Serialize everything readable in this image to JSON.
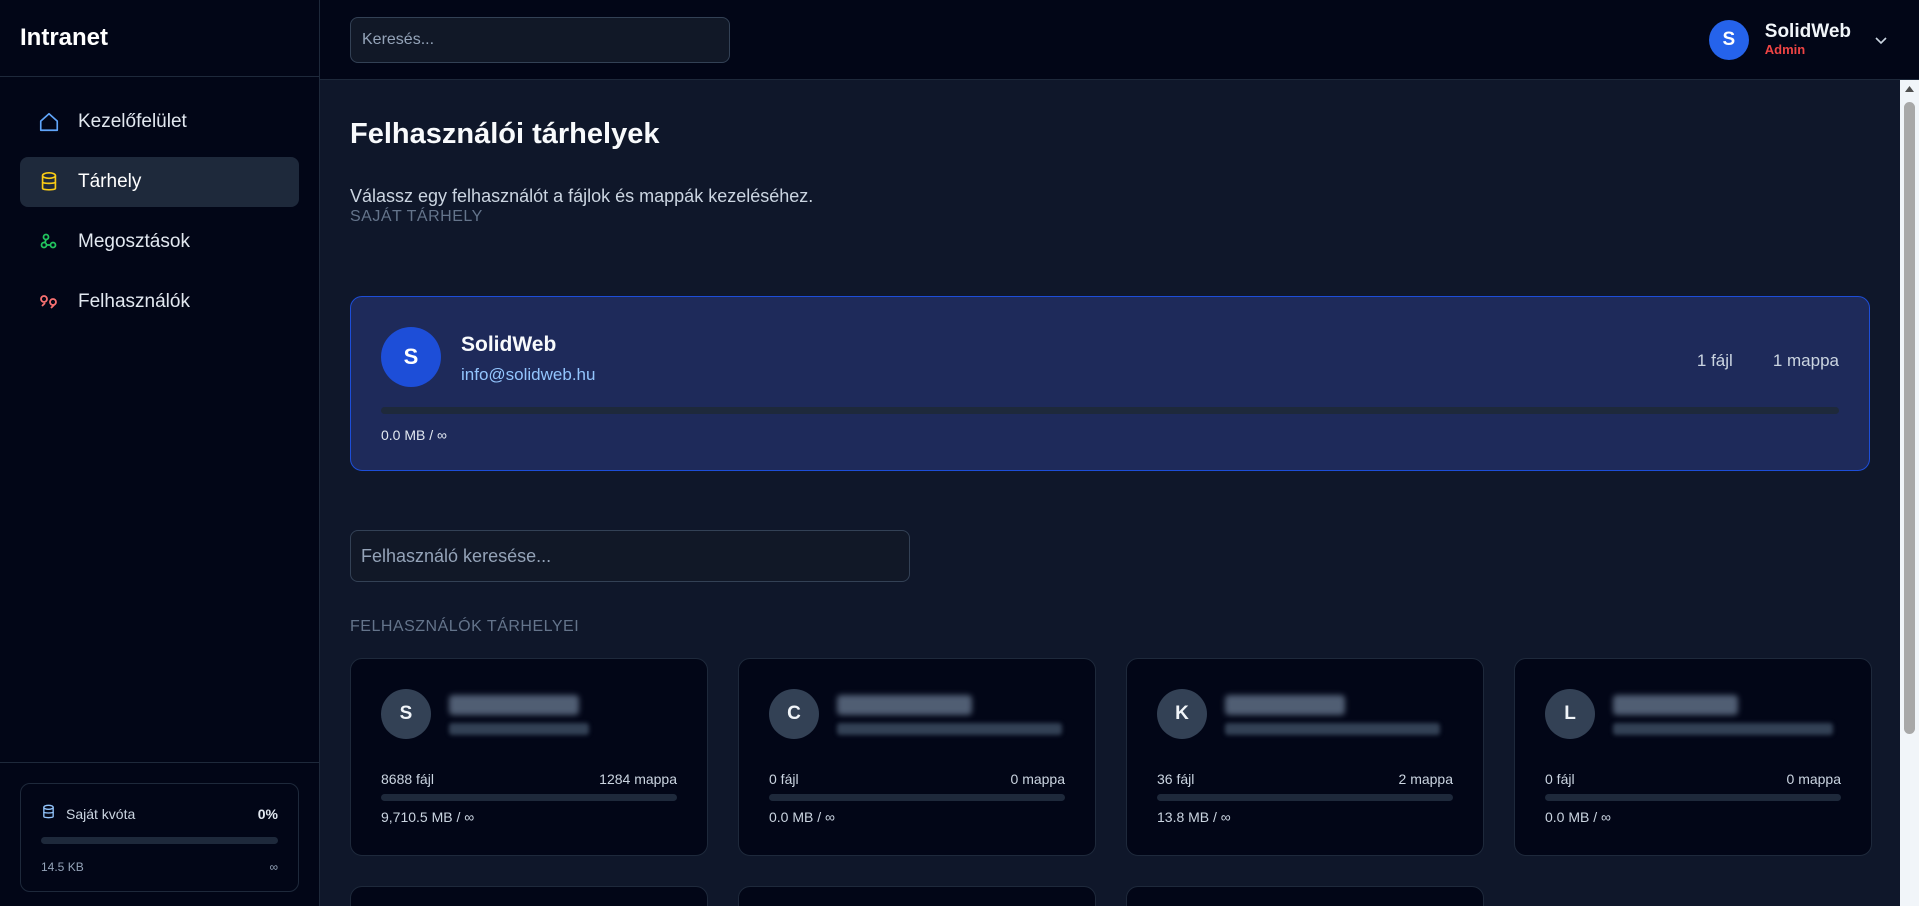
{
  "sidebar": {
    "brand": "Intranet",
    "items": [
      {
        "label": "Kezelőfelület",
        "icon": "home-icon",
        "color": "#60a5fa"
      },
      {
        "label": "Tárhely",
        "icon": "database-icon",
        "color": "#facc15"
      },
      {
        "label": "Megosztások",
        "icon": "share-icon",
        "color": "#22c55e"
      },
      {
        "label": "Felhasználók",
        "icon": "users-icon",
        "color": "#f87171"
      }
    ],
    "quota": {
      "label": "Saját kvóta",
      "percent": "0%",
      "used": "14.5 KB",
      "limit": "∞",
      "fill_fraction": 0
    }
  },
  "header": {
    "search_placeholder": "Keresés...",
    "user": {
      "initial": "S",
      "name": "SolidWeb",
      "role": "Admin"
    }
  },
  "main": {
    "title": "Felhasználói tárhelyek",
    "subtitle": "Válassz egy felhasználót a fájlok és mappák kezeléséhez.",
    "own_section_label": "SAJÁT TÁRHELY",
    "own": {
      "initial": "S",
      "name": "SolidWeb",
      "email": "info@solidweb.hu",
      "files": "1 fájl",
      "folders": "1 mappa",
      "size": "0.0 MB / ∞"
    },
    "user_search_placeholder": "Felhasználó keresése...",
    "users_section_label": "FELHASZNÁLÓK TÁRHELYEI",
    "users": [
      {
        "initial": "S",
        "files": "8688 fájl",
        "folders": "1284 mappa",
        "size": "9,710.5 MB / ∞"
      },
      {
        "initial": "C",
        "files": "0 fájl",
        "folders": "0 mappa",
        "size": "0.0 MB / ∞"
      },
      {
        "initial": "K",
        "files": "36 fájl",
        "folders": "2 mappa",
        "size": "13.8 MB / ∞"
      },
      {
        "initial": "L",
        "files": "0 fájl",
        "folders": "0 mappa",
        "size": "0.0 MB / ∞"
      }
    ]
  },
  "colors": {
    "accent": "#2563eb",
    "admin": "#ef4444"
  }
}
